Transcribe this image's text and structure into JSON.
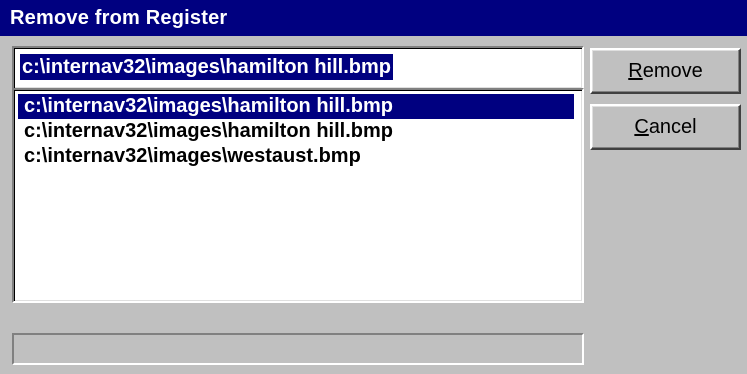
{
  "window": {
    "title": "Remove from Register"
  },
  "filename_field": {
    "value": "c:\\internav32\\images\\hamilton hill.bmp"
  },
  "file_list": {
    "items": [
      {
        "label": "c:\\internav32\\images\\hamilton hill.bmp",
        "selected": true
      },
      {
        "label": "c:\\internav32\\images\\hamilton hill.bmp",
        "selected": false
      },
      {
        "label": "c:\\internav32\\images\\westaust.bmp",
        "selected": false
      }
    ]
  },
  "buttons": {
    "remove": {
      "mnemonic": "R",
      "rest": "emove"
    },
    "cancel": {
      "mnemonic": "C",
      "rest": "ancel"
    }
  },
  "status_bar": {
    "text": ""
  },
  "colors": {
    "title_bar": "#000080",
    "selection": "#000080",
    "face": "#c0c0c0"
  }
}
